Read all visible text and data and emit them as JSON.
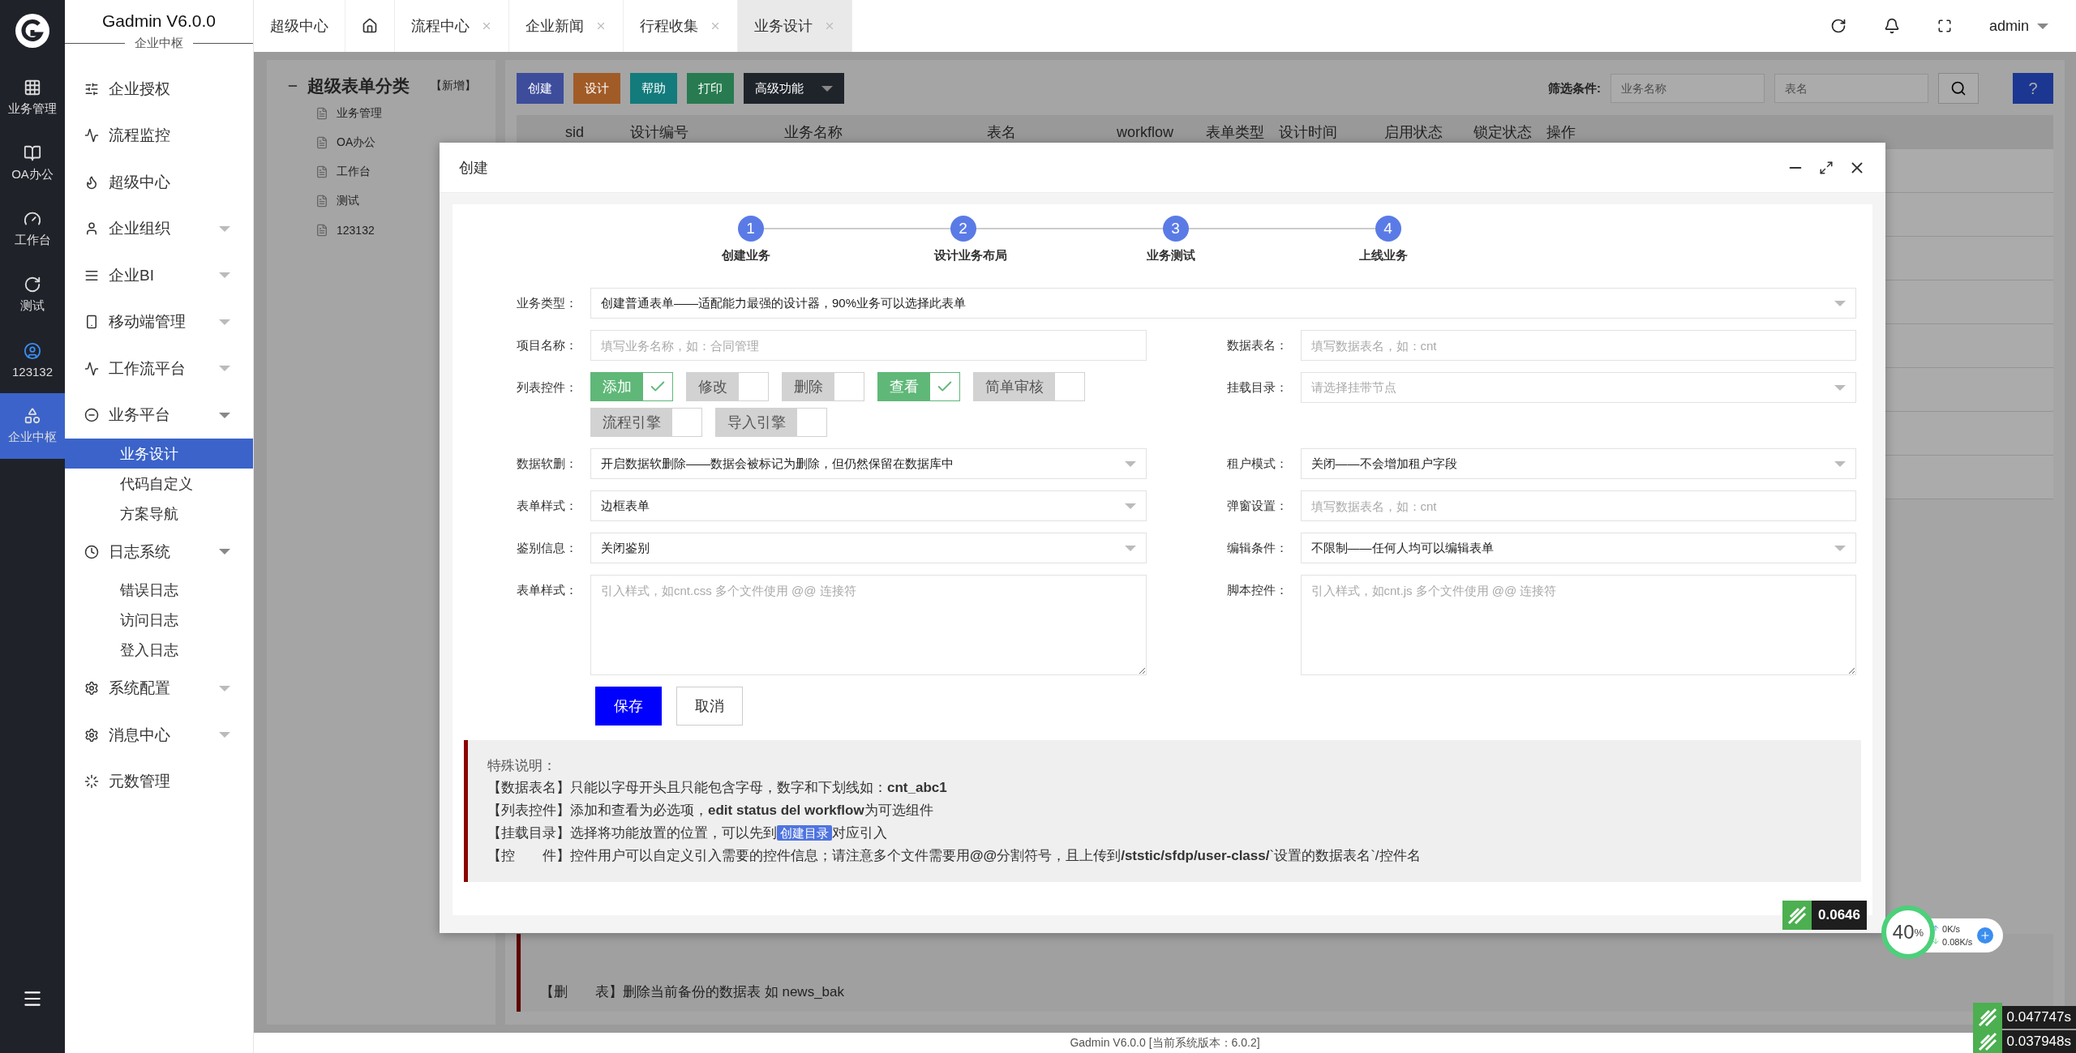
{
  "rail": {
    "items": [
      {
        "label": "业务管理",
        "selected": false
      },
      {
        "label": "OA办公",
        "selected": false
      },
      {
        "label": "工作台",
        "selected": false
      },
      {
        "label": "测试",
        "selected": false
      },
      {
        "label": "123132",
        "selected": false
      },
      {
        "label": "企业中枢",
        "selected": true
      }
    ]
  },
  "sidebar": {
    "title": "Gadmin V6.0.0",
    "subtitle": "企业中枢",
    "items": [
      {
        "label": "企业授权",
        "kind": "link"
      },
      {
        "label": "流程监控",
        "kind": "link"
      },
      {
        "label": "超级中心",
        "kind": "link"
      },
      {
        "label": "企业组织",
        "kind": "group",
        "expanded": false
      },
      {
        "label": "企业BI",
        "kind": "group",
        "expanded": false
      },
      {
        "label": "移动端管理",
        "kind": "group",
        "expanded": false
      },
      {
        "label": "工作流平台",
        "kind": "group",
        "expanded": false
      },
      {
        "label": "业务平台",
        "kind": "group",
        "expanded": true,
        "children": [
          {
            "label": "业务设计",
            "selected": true
          },
          {
            "label": "代码自定义",
            "selected": false
          },
          {
            "label": "方案导航",
            "selected": false
          }
        ]
      },
      {
        "label": "日志系统",
        "kind": "group",
        "expanded": true,
        "children": [
          {
            "label": "错误日志",
            "selected": false
          },
          {
            "label": "访问日志",
            "selected": false
          },
          {
            "label": "登入日志",
            "selected": false
          }
        ]
      },
      {
        "label": "系统配置",
        "kind": "group",
        "expanded": false
      },
      {
        "label": "消息中心",
        "kind": "group",
        "expanded": false
      },
      {
        "label": "元数管理",
        "kind": "link"
      }
    ]
  },
  "tabs": [
    {
      "kind": "text",
      "label": "超级中心",
      "closable": false,
      "selected": false
    },
    {
      "kind": "home",
      "closable": false,
      "selected": false
    },
    {
      "kind": "text",
      "label": "流程中心",
      "closable": true,
      "selected": false
    },
    {
      "kind": "text",
      "label": "企业新闻",
      "closable": true,
      "selected": false
    },
    {
      "kind": "text",
      "label": "行程收集",
      "closable": true,
      "selected": false
    },
    {
      "kind": "text",
      "label": "业务设计",
      "closable": true,
      "selected": true
    }
  ],
  "header": {
    "user": "admin"
  },
  "background": {
    "tree": {
      "title": "超级表单分类",
      "action": "【新增】",
      "items": [
        "业务管理",
        "OA办公",
        "工作台",
        "测试",
        "123132"
      ]
    },
    "toolbar": {
      "buttons": [
        {
          "label": "创建",
          "kind": "plain",
          "color": "#3d4d9b"
        },
        {
          "label": "设计",
          "kind": "plain",
          "color": "#a15b27"
        },
        {
          "label": "帮助",
          "kind": "plain",
          "color": "#137b7b"
        },
        {
          "label": "打印",
          "kind": "plain",
          "color": "#287b50"
        },
        {
          "label": "高级功能",
          "kind": "dropdown",
          "color": "#1f242b"
        }
      ],
      "filter_label": "筛选条件:",
      "filters": [
        {
          "placeholder": "业务名称"
        },
        {
          "placeholder": "表名"
        }
      ],
      "help": "?"
    },
    "table": {
      "columns": [
        "sid",
        "设计编号",
        "业务名称",
        "表名",
        "workflow",
        "表单类型",
        "设计时间",
        "启用状态",
        "锁定状态",
        "操作"
      ]
    },
    "notes": [
      "【删　　表】删除当前备份的数据表 如 news_bak"
    ]
  },
  "modal": {
    "title": "创建",
    "steps": [
      {
        "number": "1",
        "label": "创建业务"
      },
      {
        "number": "2",
        "label": "设计业务布局"
      },
      {
        "number": "3",
        "label": "业务测试"
      },
      {
        "number": "4",
        "label": "上线业务"
      }
    ],
    "rows": [
      {
        "fields": [
          {
            "label": "业务类型：",
            "kind": "select",
            "value": "创建普通表单——适配能力最强的设计器，90%业务可以选择此表单"
          }
        ]
      },
      {
        "fields": [
          {
            "label": "项目名称：",
            "kind": "input",
            "placeholder": "填写业务名称，如：合同管理"
          },
          {
            "label": "数据表名：",
            "kind": "input",
            "placeholder": "填写数据表名，如：cnt"
          }
        ]
      },
      {
        "fields": [
          {
            "label": "列表控件：",
            "kind": "toggles",
            "options": [
              {
                "label": "添加",
                "checked": true
              },
              {
                "label": "修改",
                "checked": false
              },
              {
                "label": "删除",
                "checked": false
              },
              {
                "label": "查看",
                "checked": true
              },
              {
                "label": "简单审核",
                "checked": false
              },
              {
                "label": "流程引擎",
                "checked": false
              },
              {
                "label": "导入引擎",
                "checked": false
              }
            ]
          },
          {
            "label": "挂载目录：",
            "kind": "select",
            "placeholder": "请选择挂带节点"
          }
        ]
      },
      {
        "fields": [
          {
            "label": "数据软删：",
            "kind": "select",
            "value": "开启数据软删除——数据会被标记为删除，但仍然保留在数据库中"
          },
          {
            "label": "租户模式：",
            "kind": "select",
            "value": "关闭——不会增加租户字段"
          }
        ]
      },
      {
        "fields": [
          {
            "label": "表单样式：",
            "kind": "select",
            "value": "边框表单"
          },
          {
            "label": "弹窗设置：",
            "kind": "input",
            "placeholder": "填写数据表名，如：cnt"
          }
        ]
      },
      {
        "fields": [
          {
            "label": "鉴别信息：",
            "kind": "select",
            "value": "关闭鉴别"
          },
          {
            "label": "编辑条件：",
            "kind": "select",
            "value": "不限制——任何人均可以编辑表单"
          }
        ]
      },
      {
        "fields": [
          {
            "label": "表单样式：",
            "kind": "textarea",
            "placeholder": "引入样式，如cnt.css 多个文件使用 @@ 连接符"
          },
          {
            "label": "脚本控件：",
            "kind": "textarea",
            "placeholder": "引入样式，如cnt.js 多个文件使用 @@ 连接符"
          }
        ]
      }
    ],
    "buttons": [
      {
        "label": "保存",
        "kind": "primary"
      },
      {
        "label": "取消",
        "kind": "default"
      }
    ],
    "notes": {
      "title": "特殊说明：",
      "lines": [
        {
          "text": "【数据表名】只能以字母开头且只能包含字母，数字和下划线如：**cnt_abc1**"
        },
        {
          "text": "【列表控件】添加和查看为必选项，**edit status del workflow**为可选组件"
        },
        {
          "text": "【挂载目录】选择将功能放置的位置，可以先到",
          "link": "创建目录",
          "after": "对应引入"
        },
        {
          "text": "【控　　件】控件用户可以自定义引入需要的控件信息；请注意多个文件需要用**@@**分割符号，且上传到**/ststic/sfdp/user-class/**`设置的数据表名`/控件名"
        }
      ]
    }
  },
  "footer": "Gadmin V6.0.0 [当前系统版本：6.0.2]",
  "widgets": {
    "speed": "0.0646",
    "cpu": "40",
    "cpu_unit": "%",
    "upload": "0K/s",
    "download": "0.08K/s",
    "timers": [
      "0.047747s",
      "0.037948s"
    ]
  }
}
